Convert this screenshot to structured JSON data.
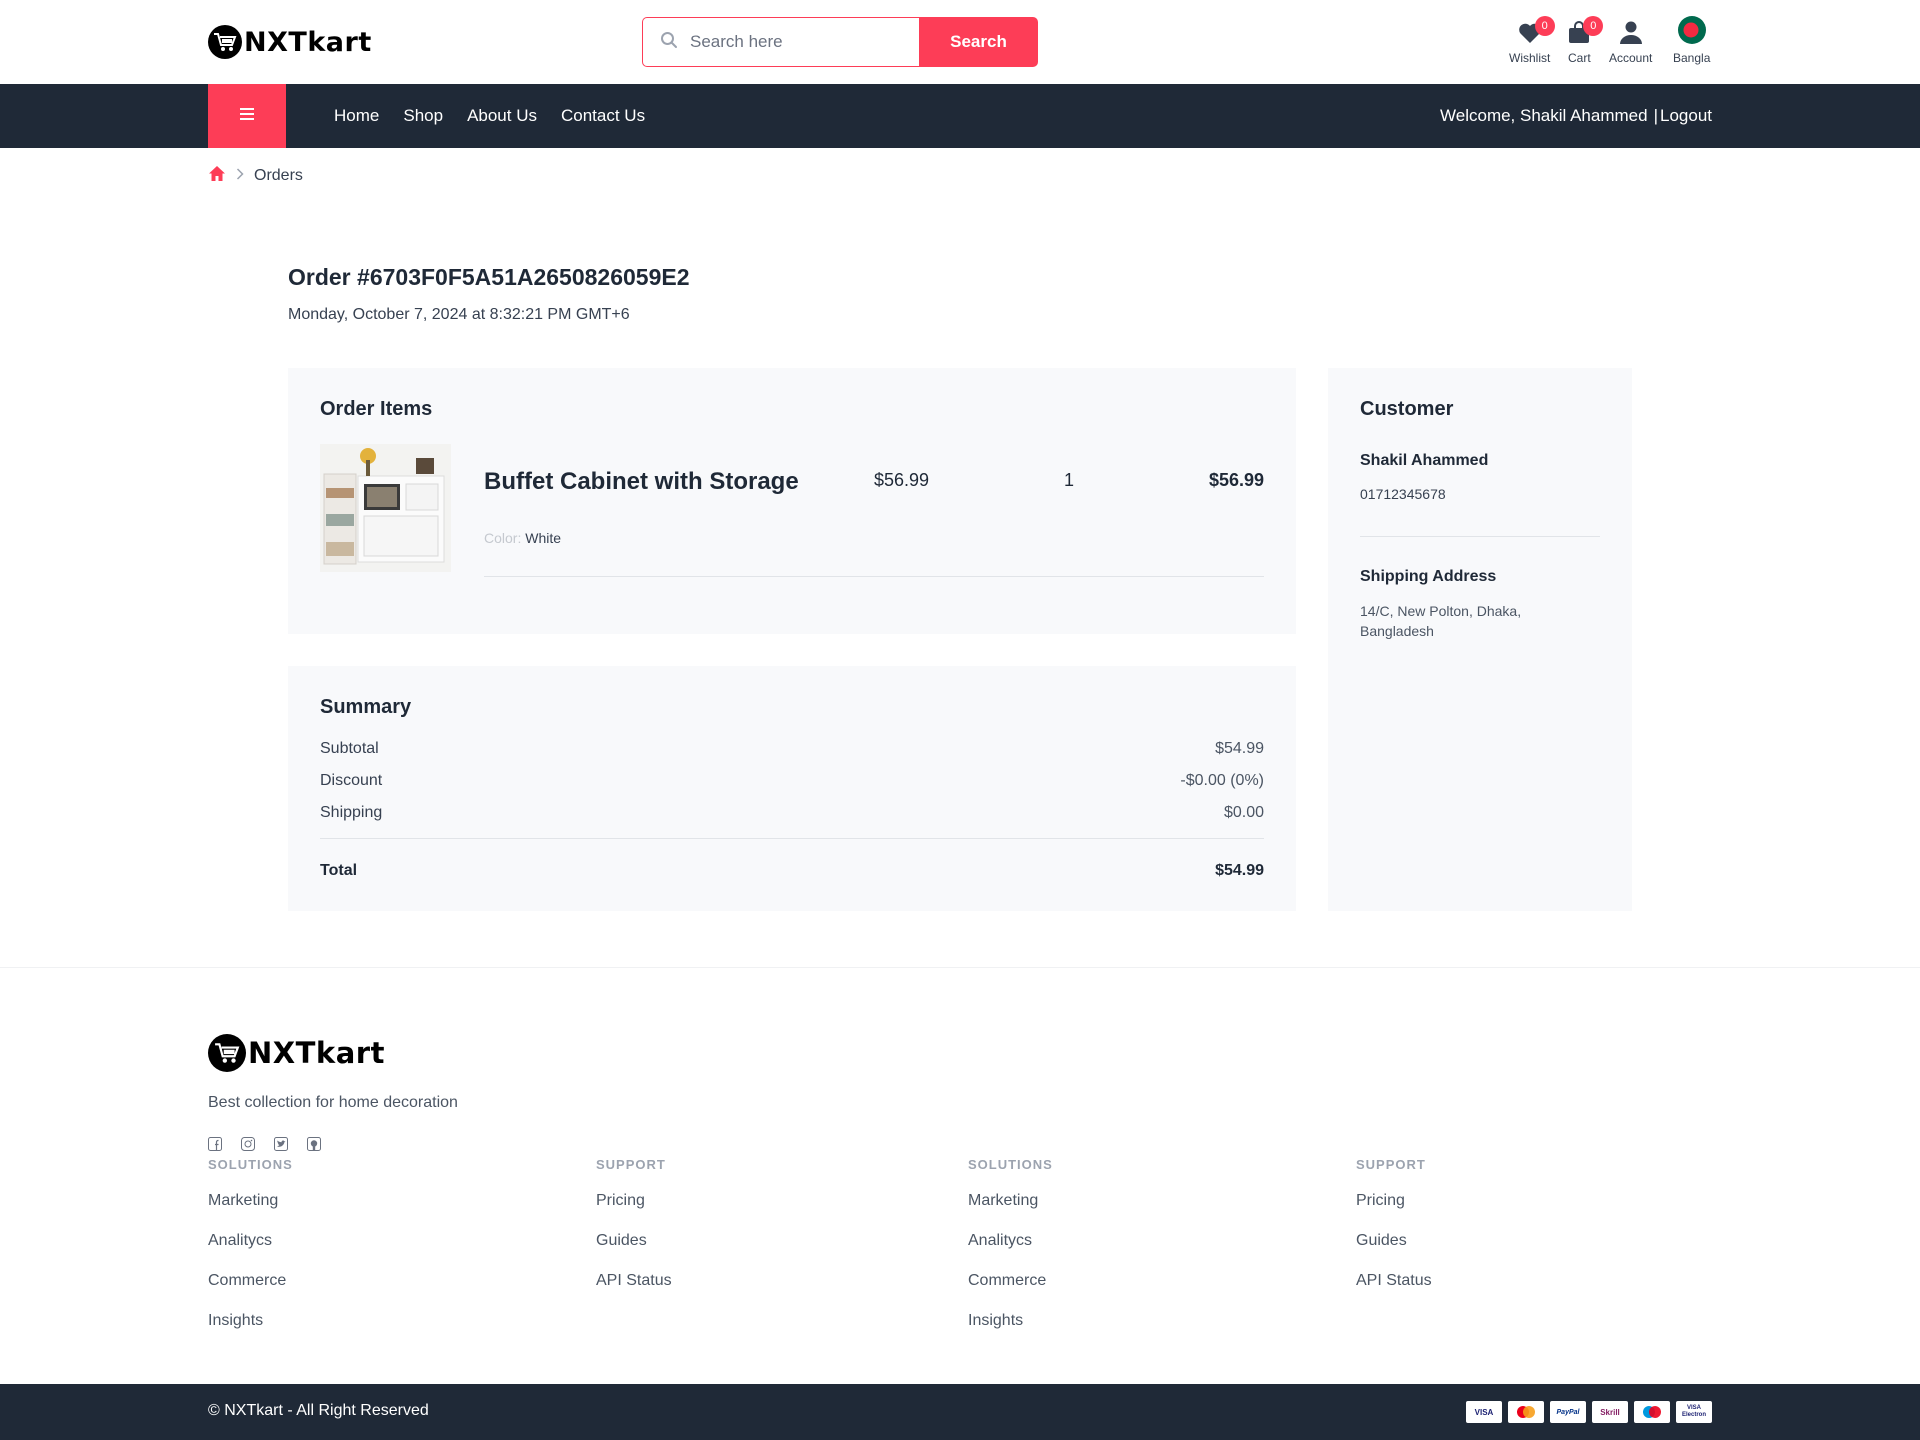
{
  "brand": {
    "name": "NXTkart",
    "accent": "#fd3d57",
    "dark": "#1f2937"
  },
  "header": {
    "search_placeholder": "Search here",
    "search_button": "Search",
    "wishlist": {
      "label": "Wishlist",
      "count": "0",
      "icon": "heart-icon"
    },
    "cart": {
      "label": "Cart",
      "count": "0",
      "icon": "bag-icon"
    },
    "account": {
      "label": "Account",
      "icon": "user-icon"
    },
    "language": {
      "label": "Bangla",
      "icon": "bangladesh-flag-icon"
    }
  },
  "nav": {
    "links": [
      "Home",
      "Shop",
      "About Us",
      "Contact Us"
    ],
    "welcome": "Welcome, Shakil Ahammed",
    "separator": "|",
    "logout": "Logout"
  },
  "breadcrumb": {
    "current": "Orders"
  },
  "order": {
    "title": "Order #6703F0F5A51A2650826059E2",
    "date": "Monday, October 7, 2024 at 8:32:21 PM GMT+6",
    "items_title": "Order Items",
    "items": [
      {
        "name": "Buffet Cabinet with Storage",
        "price": "$56.99",
        "quantity": "1",
        "total": "$56.99",
        "variant_label": "Color:",
        "variant_value": "White"
      }
    ],
    "summary": {
      "title": "Summary",
      "subtotal_label": "Subtotal",
      "subtotal": "$54.99",
      "discount_label": "Discount",
      "discount": "-$0.00 (0%)",
      "shipping_label": "Shipping",
      "shipping": "$0.00",
      "total_label": "Total",
      "total": "$54.99"
    },
    "customer": {
      "title": "Customer",
      "name": "Shakil Ahammed",
      "phone": "01712345678",
      "shipping_title": "Shipping Address",
      "shipping_address": "14/C, New Polton, Dhaka, Bangladesh"
    }
  },
  "footer": {
    "tagline": "Best collection for home decoration",
    "socials": [
      "facebook-icon",
      "instagram-icon",
      "twitter-icon",
      "github-icon"
    ],
    "columns": [
      {
        "heading": "SOLUTIONS",
        "links": [
          "Marketing",
          "Analitycs",
          "Commerce",
          "Insights"
        ]
      },
      {
        "heading": "SUPPORT",
        "links": [
          "Pricing",
          "Guides",
          "API Status"
        ]
      },
      {
        "heading": "SOLUTIONS",
        "links": [
          "Marketing",
          "Analitycs",
          "Commerce",
          "Insights"
        ]
      },
      {
        "heading": "SUPPORT",
        "links": [
          "Pricing",
          "Guides",
          "API Status"
        ]
      }
    ],
    "copyright": "© NXTkart - All Right Reserved",
    "payments": [
      "VISA",
      "mastercard",
      "PayPal",
      "Skrill",
      "maestro",
      "VISA Electron"
    ]
  }
}
